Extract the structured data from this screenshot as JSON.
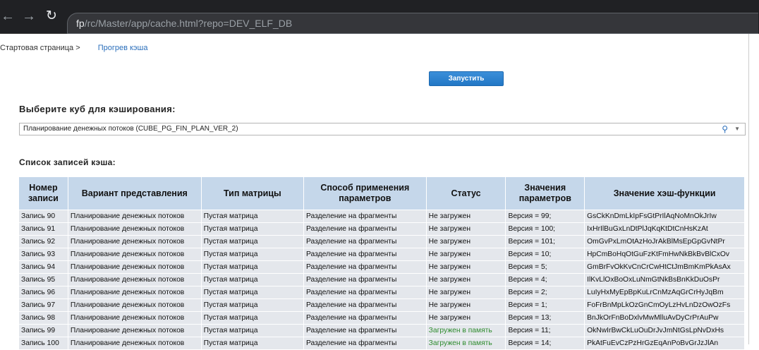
{
  "browser": {
    "url_host": "fp",
    "url_path": "/rc/Master/app/cache.html?repo=DEV_ELF_DB"
  },
  "breadcrumb": {
    "home": "Стартовая страница >",
    "current": "Прогрев кэша"
  },
  "run_button": "Запустить",
  "cube_section": {
    "title": "Выберите куб для кэширования:",
    "selected": "Планирование денежных потоков (CUBE_PG_FIN_PLAN_VER_2)"
  },
  "list_title": "Список записей кэша:",
  "table": {
    "headers": [
      "Номер записи",
      "Вариант представления",
      "Тип матрицы",
      "Способ применения параметров",
      "Статус",
      "Значения параметров",
      "Значение хэш-функции"
    ],
    "rows": [
      [
        "Запись 90",
        "Планирование денежных потоков",
        "Пустая матрица",
        "Разделение на фрагменты",
        "Не загружен",
        "Версия = 99;",
        "GsCkKnDmLkIpFsGtPrIlAqNoMnOkJrIw"
      ],
      [
        "Запись 91",
        "Планирование денежных потоков",
        "Пустая матрица",
        "Разделение на фрагменты",
        "Не загружен",
        "Версия = 100;",
        "IxHrIlBuGxLnDtPlJqKqKtDtCnHsKzAt"
      ],
      [
        "Запись 92",
        "Планирование денежных потоков",
        "Пустая матрица",
        "Разделение на фрагменты",
        "Не загружен",
        "Версия = 101;",
        "OmGvPxLmOtAzHoJrAkBlMsEpGpGvNtPr"
      ],
      [
        "Запись 93",
        "Планирование денежных потоков",
        "Пустая матрица",
        "Разделение на фрагменты",
        "Не загружен",
        "Версия = 10;",
        "HpCmBoHqOtGuFzKtFmHwNkBkBvBlCxOv"
      ],
      [
        "Запись 94",
        "Планирование денежных потоков",
        "Пустая матрица",
        "Разделение на фрагменты",
        "Не загружен",
        "Версия = 5;",
        "GmBrFvOkKvCnCrCwHtCtJmBmKmPkAsAx"
      ],
      [
        "Запись 95",
        "Планирование денежных потоков",
        "Пустая матрица",
        "Разделение на фрагменты",
        "Не загружен",
        "Версия = 4;",
        "IlKvLlOxBoOxLuNmGtNkBsBnKkDuOsPr"
      ],
      [
        "Запись 96",
        "Планирование денежных потоков",
        "Пустая матрица",
        "Разделение на фрагменты",
        "Не загружен",
        "Версия = 2;",
        "LuIyHxMyEpBpKuLrCnMzAqGrCrHyJqBm"
      ],
      [
        "Запись 97",
        "Планирование денежных потоков",
        "Пустая матрица",
        "Разделение на фрагменты",
        "Не загружен",
        "Версия = 1;",
        "FoFrBnMpLkOzGnCmOyLzHvLnDzOwOzFs"
      ],
      [
        "Запись 98",
        "Планирование денежных потоков",
        "Пустая матрица",
        "Разделение на фрагменты",
        "Не загружен",
        "Версия = 13;",
        "BnJkOrFnBoDxlvMwMlluAvDyCrPrAuPw"
      ],
      [
        "Запись 99",
        "Планирование денежных потоков",
        "Пустая матрица",
        "Разделение на фрагменты",
        "Загружен в память",
        "Версия = 11;",
        "OkNwIrBwCkLuOuDrJvJmNtGsLpNvDxHs"
      ],
      [
        "Запись 100",
        "Планирование денежных потоков",
        "Пустая матрица",
        "Разделение на фрагменты",
        "Загружен в память",
        "Версия = 14;",
        "PkAtFuEvCzPzHrGzEqAnPoBvGrJzJlAn"
      ]
    ]
  },
  "colors": {
    "header_bg": "#c5d7ea",
    "row_bg": "#e4e7ec",
    "loaded_status": "#2e8b2e",
    "button": "#2277c5"
  }
}
